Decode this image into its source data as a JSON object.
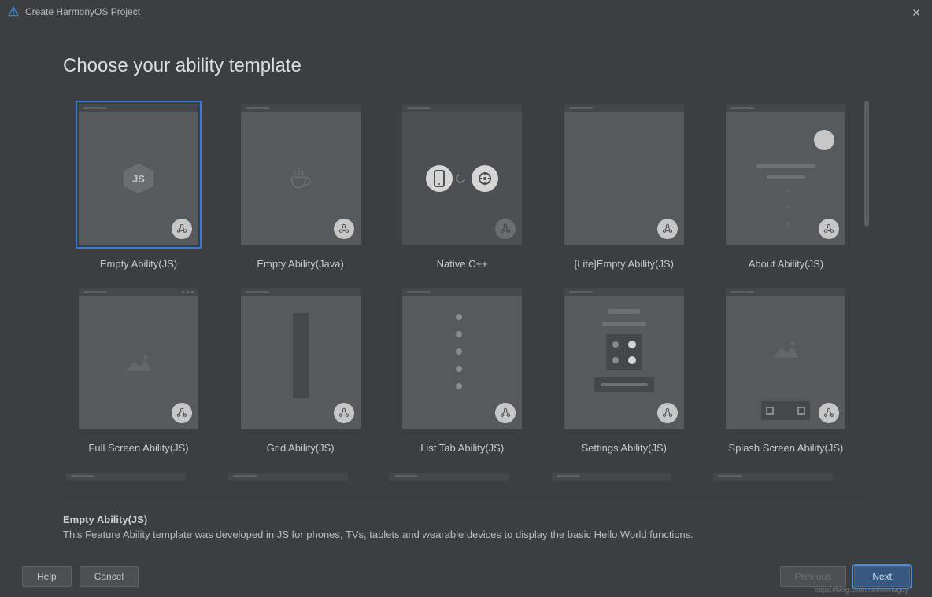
{
  "window": {
    "title": "Create HarmonyOS Project",
    "heading": "Choose your ability template"
  },
  "templates": [
    {
      "label": "Empty Ability(JS)",
      "selected": true
    },
    {
      "label": "Empty Ability(Java)"
    },
    {
      "label": "Native C++"
    },
    {
      "label": "[Lite]Empty Ability(JS)"
    },
    {
      "label": "About Ability(JS)"
    },
    {
      "label": "Full Screen Ability(JS)"
    },
    {
      "label": "Grid Ability(JS)"
    },
    {
      "label": "List Tab Ability(JS)"
    },
    {
      "label": "Settings Ability(JS)"
    },
    {
      "label": "Splash Screen Ability(JS)"
    }
  ],
  "details": {
    "title": "Empty Ability(JS)",
    "description": "This Feature Ability template was developed in JS for phones, TVs, tablets and wearable devices to display the basic Hello World functions."
  },
  "footer": {
    "help": "Help",
    "cancel": "Cancel",
    "previous": "Previous",
    "next": "Next"
  },
  "watermark": "https://blog.csdn.net/nokiaguy"
}
